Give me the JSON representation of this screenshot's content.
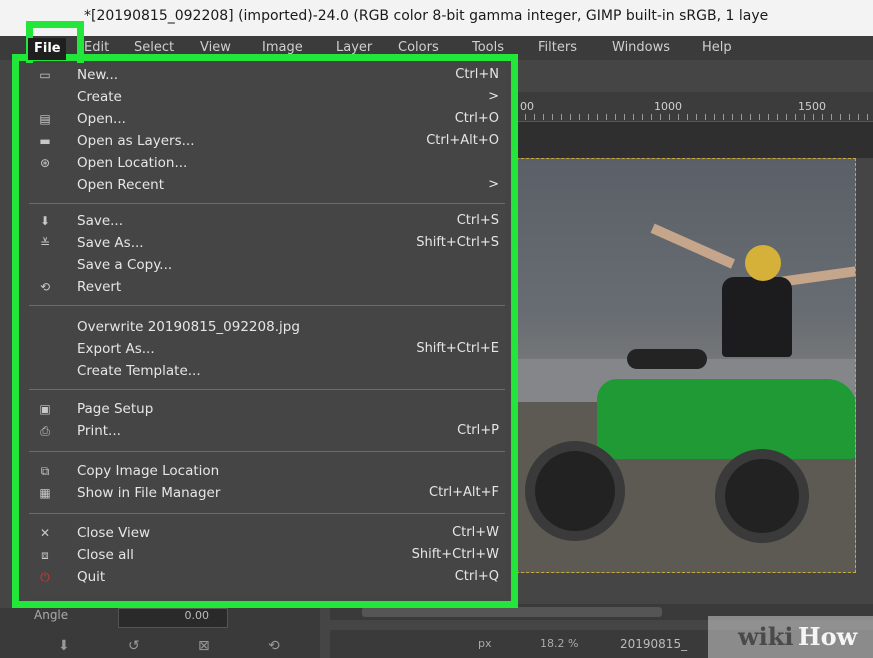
{
  "window": {
    "title": "*[20190815_092208] (imported)-24.0 (RGB color 8-bit gamma integer, GIMP built-in sRGB, 1 laye"
  },
  "menubar": {
    "items": [
      {
        "label": "File"
      },
      {
        "label": "Edit"
      },
      {
        "label": "Select"
      },
      {
        "label": "View"
      },
      {
        "label": "Image"
      },
      {
        "label": "Layer"
      },
      {
        "label": "Colors"
      },
      {
        "label": "Tools"
      },
      {
        "label": "Filters"
      },
      {
        "label": "Windows"
      },
      {
        "label": "Help"
      }
    ]
  },
  "ruler": {
    "ticks": [
      "00",
      "1000",
      "1500"
    ]
  },
  "file_menu": {
    "items": [
      {
        "label": "New...",
        "accel": "Ctrl+N",
        "icon": "new-icon"
      },
      {
        "label": "Create",
        "accel": ">",
        "icon": ""
      },
      {
        "label": "Open...",
        "accel": "Ctrl+O",
        "icon": "open-icon"
      },
      {
        "label": "Open as Layers...",
        "accel": "Ctrl+Alt+O",
        "icon": "open-layers-icon"
      },
      {
        "label": "Open Location...",
        "accel": "",
        "icon": "globe-icon"
      },
      {
        "label": "Open Recent",
        "accel": ">",
        "icon": ""
      },
      {
        "label": "Save...",
        "accel": "Ctrl+S",
        "icon": "save-icon"
      },
      {
        "label": "Save As...",
        "accel": "Shift+Ctrl+S",
        "icon": "save-as-icon"
      },
      {
        "label": "Save a Copy...",
        "accel": "",
        "icon": ""
      },
      {
        "label": "Revert",
        "accel": "",
        "icon": "revert-icon"
      },
      {
        "label": "Overwrite 20190815_092208.jpg",
        "accel": "",
        "icon": ""
      },
      {
        "label": "Export As...",
        "accel": "Shift+Ctrl+E",
        "icon": ""
      },
      {
        "label": "Create Template...",
        "accel": "",
        "icon": ""
      },
      {
        "label": "Page Setup",
        "accel": "",
        "icon": "page-setup-icon"
      },
      {
        "label": "Print...",
        "accel": "Ctrl+P",
        "icon": "print-icon"
      },
      {
        "label": "Copy Image Location",
        "accel": "",
        "icon": "copy-location-icon"
      },
      {
        "label": "Show in File Manager",
        "accel": "Ctrl+Alt+F",
        "icon": "file-manager-icon"
      },
      {
        "label": "Close View",
        "accel": "Ctrl+W",
        "icon": "close-icon"
      },
      {
        "label": "Close all",
        "accel": "Shift+Ctrl+W",
        "icon": "close-all-icon"
      },
      {
        "label": "Quit",
        "accel": "Ctrl+Q",
        "icon": "quit-icon"
      }
    ]
  },
  "bottom_panel": {
    "angle_label": "Angle",
    "angle_value": "0.00"
  },
  "statusbar": {
    "unit": "px",
    "zoom": "18.2 %",
    "filename": "20190815_"
  },
  "watermark": {
    "wiki": "wiki",
    "how": "How"
  },
  "colors": {
    "highlight_border": "#22e63a",
    "menu_bg": "#454545",
    "quit_icon": "#e0322c"
  }
}
